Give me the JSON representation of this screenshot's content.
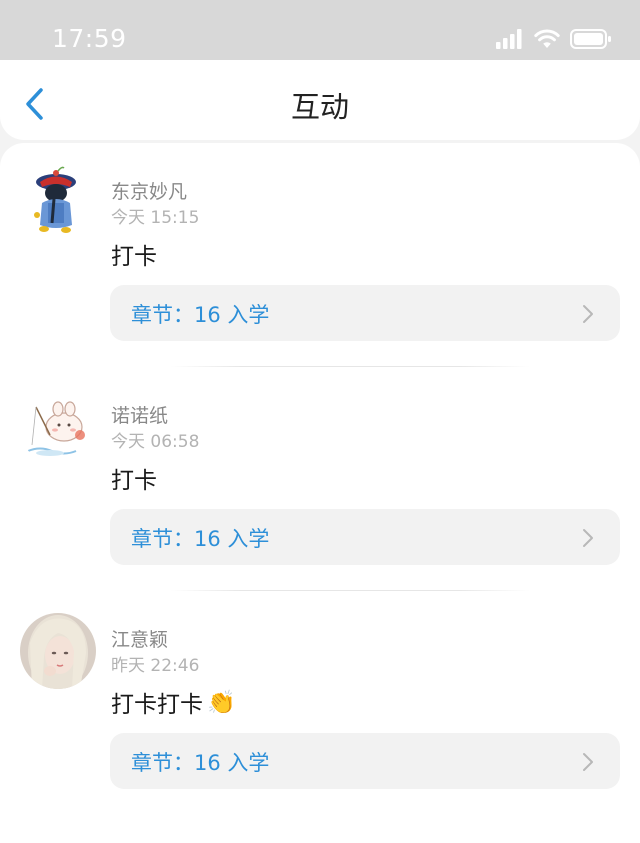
{
  "status_bar": {
    "time": "17:59"
  },
  "nav": {
    "title": "互动"
  },
  "posts": [
    {
      "username": "东京妙凡",
      "timestamp": "今天 15:15",
      "text": "打卡",
      "emoji": "",
      "chapter": "章节：16 入学"
    },
    {
      "username": "诺诺纸",
      "timestamp": "今天 06:58",
      "text": "打卡",
      "emoji": "",
      "chapter": "章节：16 入学"
    },
    {
      "username": "江意颖",
      "timestamp": "昨天 22:46",
      "text": "打卡打卡",
      "emoji": "👏",
      "chapter": "章节：16 入学"
    }
  ],
  "colors": {
    "accent": "#2d8fd8",
    "status_bar_bg": "#d8d8d8",
    "card_bg": "#f2f2f2"
  }
}
